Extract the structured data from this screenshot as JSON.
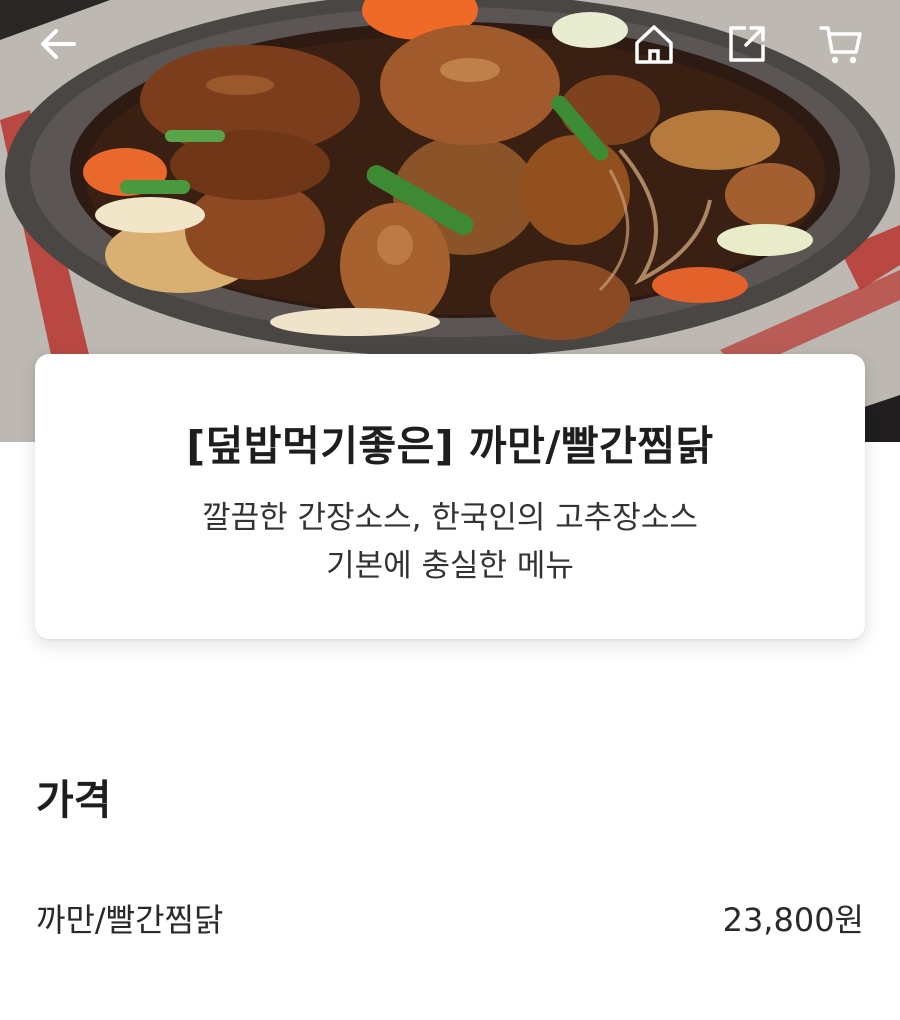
{
  "header": {
    "icons": {
      "back": "arrow-left-icon",
      "home": "home-icon",
      "share": "share-icon",
      "cart": "cart-icon"
    },
    "icon_color": "#ffffff"
  },
  "hero": {
    "image": "braised-chicken-dish-photo"
  },
  "product": {
    "title": "[덮밥먹기좋은] 까만/빨간찜닭",
    "description_line1": "깔끔한 간장소스, 한국인의 고추장소스",
    "description_line2": "기본에 충실한 메뉴"
  },
  "price_section": {
    "heading": "가격",
    "items": [
      {
        "name": "까만/빨간찜닭",
        "price": "23,800원"
      }
    ]
  }
}
